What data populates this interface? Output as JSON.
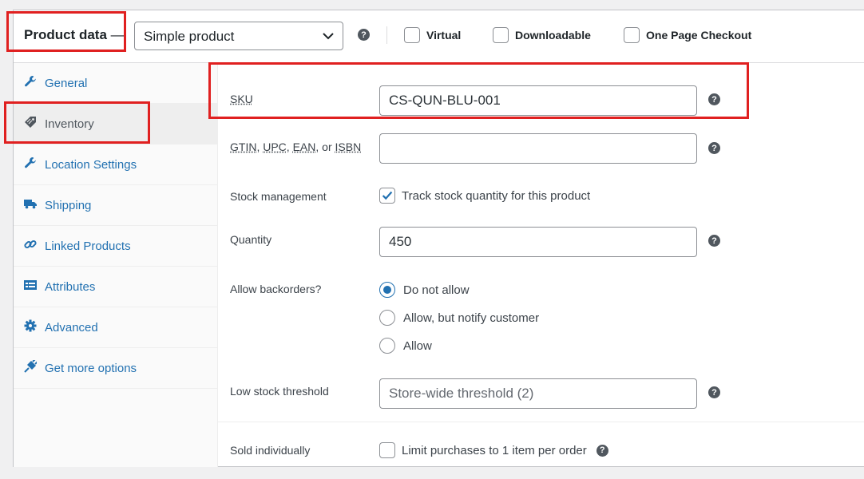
{
  "header": {
    "title": "Product data",
    "dash": "—",
    "product_type": "Simple product",
    "checks": [
      {
        "label": "Virtual",
        "checked": false
      },
      {
        "label": "Downloadable",
        "checked": false
      },
      {
        "label": "One Page Checkout",
        "checked": false
      }
    ]
  },
  "sidebar": {
    "items": [
      {
        "label": "General",
        "icon": "wrench-icon"
      },
      {
        "label": "Inventory",
        "icon": "tag-icon",
        "active": true
      },
      {
        "label": "Location Settings",
        "icon": "wrench-icon"
      },
      {
        "label": "Shipping",
        "icon": "truck-icon"
      },
      {
        "label": "Linked Products",
        "icon": "link-icon"
      },
      {
        "label": "Attributes",
        "icon": "list-icon"
      },
      {
        "label": "Advanced",
        "icon": "gear-icon"
      },
      {
        "label": "Get more options",
        "icon": "plug-icon"
      }
    ]
  },
  "inventory": {
    "sku_label": "SKU",
    "sku_value": "CS-QUN-BLU-001",
    "gtin_parts": [
      "GTIN",
      "UPC",
      "EAN",
      "ISBN"
    ],
    "gtin_sep1": ", ",
    "gtin_sep2": ", ",
    "gtin_sep3": ", or ",
    "gtin_value": "",
    "stock_label": "Stock management",
    "stock_check_label": "Track stock quantity for this product",
    "stock_checked": true,
    "qty_label": "Quantity",
    "qty_value": "450",
    "backorders_label": "Allow backorders?",
    "backorder_options": [
      {
        "label": "Do not allow",
        "selected": true
      },
      {
        "label": "Allow, but notify customer",
        "selected": false
      },
      {
        "label": "Allow",
        "selected": false
      }
    ],
    "low_stock_label": "Low stock threshold",
    "low_stock_placeholder": "Store-wide threshold (2)",
    "sold_label": "Sold individually",
    "sold_check_label": "Limit purchases to 1 item per order",
    "sold_checked": false
  },
  "colors": {
    "accent": "#2271b1",
    "highlight": "#e02020"
  }
}
